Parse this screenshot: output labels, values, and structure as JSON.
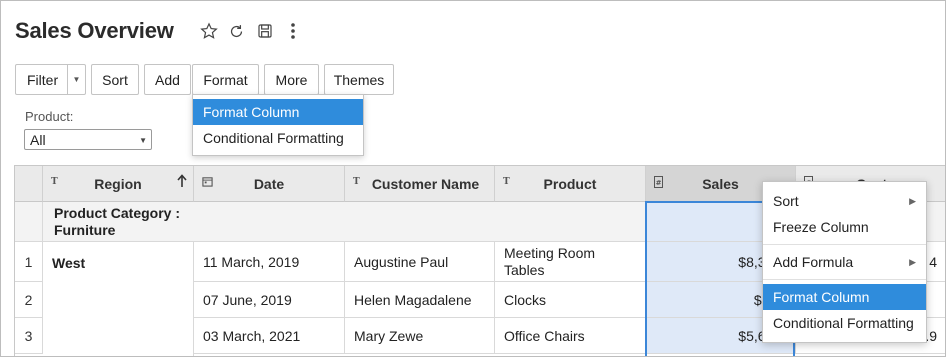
{
  "title": "Sales Overview",
  "title_icons": [
    "star-icon",
    "refresh-icon",
    "save-icon",
    "more-vert-icon"
  ],
  "toolbar": {
    "filter": "Filter",
    "sort": "Sort",
    "add": "Add",
    "format": "Format",
    "more": "More",
    "themes": "Themes"
  },
  "format_menu": [
    "Format Column",
    "Conditional Formatting"
  ],
  "filter_panel": {
    "label": "Product:",
    "value": "All"
  },
  "table": {
    "headers": {
      "region": "Region",
      "date": "Date",
      "customer": "Customer Name",
      "product": "Product",
      "sales": "Sales",
      "cost": "Cost"
    },
    "type_icons": {
      "text": "T"
    },
    "group_label": "Product Category :\nFurniture",
    "group_label_lines": [
      "Product Category :",
      "Furniture"
    ],
    "region_value": "West",
    "rows": [
      {
        "num": "1",
        "date": "11 March, 2019",
        "customer": "Augustine Paul",
        "product_lines": [
          "Meeting Room",
          "Tables"
        ],
        "sales": "$8,306.",
        "cost": "4"
      },
      {
        "num": "2",
        "date": "07 June, 2019",
        "customer": "Helen Magadalene",
        "product_lines": [
          "Clocks"
        ],
        "sales": "$748",
        "cost": ""
      },
      {
        "num": "3",
        "date": "03 March, 2021",
        "customer": "Mary Zewe",
        "product_lines": [
          "Office Chairs"
        ],
        "sales": "$5,632.",
        "cost": "$5,239.9"
      }
    ]
  },
  "context_menu": {
    "items": [
      {
        "label": "Sort",
        "submenu": true
      },
      {
        "label": "Freeze Column",
        "submenu": false
      },
      {
        "label": "Add Formula",
        "submenu": true
      },
      {
        "label": "Format Column",
        "submenu": false
      },
      {
        "label": "Conditional Formatting",
        "submenu": false
      }
    ]
  },
  "colors": {
    "accent": "#2f8cdc",
    "selection": "#dfe9f8",
    "header_bg": "#eaeaea"
  }
}
